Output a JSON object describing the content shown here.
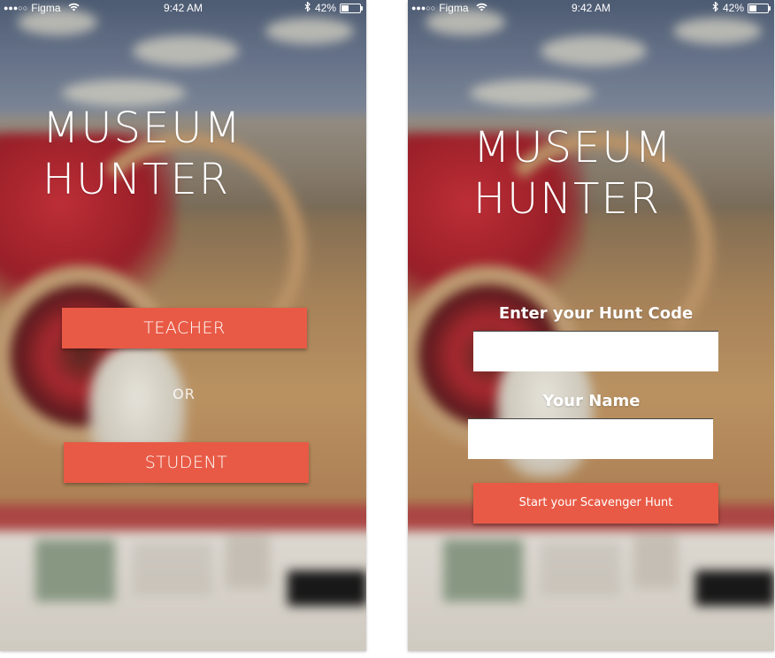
{
  "status_bar": {
    "signal": "●●●○○",
    "carrier": "Figma",
    "time": "9:42 AM",
    "battery_percent": "42%",
    "battery_level": 0.42
  },
  "screen_role": {
    "title_line1": "MUSEUM",
    "title_line2": "HUNTER",
    "teacher_label": "TEACHER",
    "or_label": "OR",
    "student_label": "STUDENT"
  },
  "screen_student": {
    "title_line1": "MUSEUM",
    "title_line2": "HUNTER",
    "hunt_code_label": "Enter your Hunt Code",
    "hunt_code_value": "",
    "name_label": "Your Name",
    "name_value": "",
    "start_label": "Start your Scavenger Hunt"
  },
  "colors": {
    "accent": "#e85a45",
    "text": "#ffffff"
  }
}
